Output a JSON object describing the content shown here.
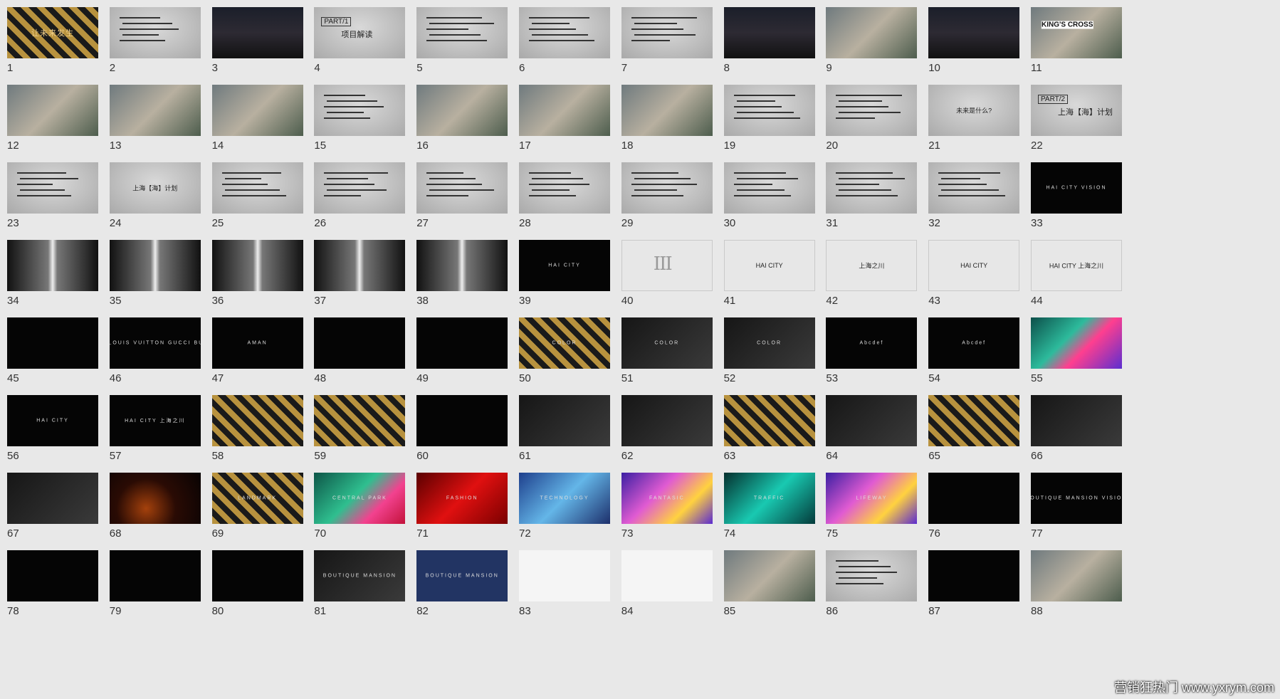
{
  "slides": [
    {
      "n": "1",
      "style": "gold",
      "caption": "让未来发生"
    },
    {
      "n": "2",
      "style": "gray"
    },
    {
      "n": "3",
      "style": "city"
    },
    {
      "n": "4",
      "style": "gray",
      "part": "PART/1",
      "part_title": "项目解读"
    },
    {
      "n": "5",
      "style": "gray"
    },
    {
      "n": "6",
      "style": "gray"
    },
    {
      "n": "7",
      "style": "gray"
    },
    {
      "n": "8",
      "style": "city"
    },
    {
      "n": "9",
      "style": "photo"
    },
    {
      "n": "10",
      "style": "city"
    },
    {
      "n": "11",
      "style": "photo",
      "caption": "KING'S CROSS"
    },
    {
      "n": "12",
      "style": "photo"
    },
    {
      "n": "13",
      "style": "photo"
    },
    {
      "n": "14",
      "style": "photo"
    },
    {
      "n": "15",
      "style": "gray"
    },
    {
      "n": "16",
      "style": "photo"
    },
    {
      "n": "17",
      "style": "photo"
    },
    {
      "n": "18",
      "style": "photo"
    },
    {
      "n": "19",
      "style": "gray"
    },
    {
      "n": "20",
      "style": "gray"
    },
    {
      "n": "21",
      "style": "gray",
      "caption": "未来是什么?"
    },
    {
      "n": "22",
      "style": "gray",
      "part": "PART/2",
      "part_title": "上海【海】计划"
    },
    {
      "n": "23",
      "style": "gray"
    },
    {
      "n": "24",
      "style": "gray",
      "caption": "上海【海】计划"
    },
    {
      "n": "25",
      "style": "gray"
    },
    {
      "n": "26",
      "style": "gray"
    },
    {
      "n": "27",
      "style": "gray"
    },
    {
      "n": "28",
      "style": "gray"
    },
    {
      "n": "29",
      "style": "gray"
    },
    {
      "n": "30",
      "style": "gray"
    },
    {
      "n": "31",
      "style": "gray"
    },
    {
      "n": "32",
      "style": "gray"
    },
    {
      "n": "33",
      "style": "black",
      "caption": "HAI CITY VISION"
    },
    {
      "n": "34",
      "style": "bw"
    },
    {
      "n": "35",
      "style": "bw"
    },
    {
      "n": "36",
      "style": "bw"
    },
    {
      "n": "37",
      "style": "bw"
    },
    {
      "n": "38",
      "style": "bw"
    },
    {
      "n": "39",
      "style": "black",
      "caption": "HAI CITY"
    },
    {
      "n": "40",
      "style": "light",
      "glyph": "III"
    },
    {
      "n": "41",
      "style": "light",
      "caption": "HAI CITY"
    },
    {
      "n": "42",
      "style": "light",
      "caption": "上海之川"
    },
    {
      "n": "43",
      "style": "light",
      "caption": "HAI CITY"
    },
    {
      "n": "44",
      "style": "light",
      "caption": "HAI CITY 上海之川"
    },
    {
      "n": "45",
      "style": "black"
    },
    {
      "n": "46",
      "style": "black",
      "caption": "CHANEL  LOUIS VUITTON  GUCCI  BURBERRY"
    },
    {
      "n": "47",
      "style": "black",
      "caption": "AMAN"
    },
    {
      "n": "48",
      "style": "black"
    },
    {
      "n": "49",
      "style": "black"
    },
    {
      "n": "50",
      "style": "gold",
      "caption": "COLOR"
    },
    {
      "n": "51",
      "style": "dark",
      "caption": "COLOR"
    },
    {
      "n": "52",
      "style": "dark",
      "caption": "COLOR"
    },
    {
      "n": "53",
      "style": "black",
      "caption": "Abcdef"
    },
    {
      "n": "54",
      "style": "black",
      "caption": "Abcdef"
    },
    {
      "n": "55",
      "style": "multi"
    },
    {
      "n": "56",
      "style": "black",
      "caption": "HAI CITY"
    },
    {
      "n": "57",
      "style": "black",
      "caption": "HAI CITY 上海之川"
    },
    {
      "n": "58",
      "style": "gold"
    },
    {
      "n": "59",
      "style": "gold"
    },
    {
      "n": "60",
      "style": "black"
    },
    {
      "n": "61",
      "style": "dark"
    },
    {
      "n": "62",
      "style": "dark"
    },
    {
      "n": "63",
      "style": "gold"
    },
    {
      "n": "64",
      "style": "dark"
    },
    {
      "n": "65",
      "style": "gold"
    },
    {
      "n": "66",
      "style": "dark"
    },
    {
      "n": "67",
      "style": "dark"
    },
    {
      "n": "68",
      "style": "orange"
    },
    {
      "n": "69",
      "style": "gold",
      "caption": "LANDMARK"
    },
    {
      "n": "70",
      "style": "pink",
      "caption": "CENTRAL PARK"
    },
    {
      "n": "71",
      "style": "red",
      "caption": "FASHION"
    },
    {
      "n": "72",
      "style": "blue",
      "caption": "TECHNOLOGY"
    },
    {
      "n": "73",
      "style": "purple",
      "caption": "FANTASIC"
    },
    {
      "n": "74",
      "style": "teal",
      "caption": "TRAFFIC"
    },
    {
      "n": "75",
      "style": "purple",
      "caption": "LIFEWAY"
    },
    {
      "n": "76",
      "style": "black"
    },
    {
      "n": "77",
      "style": "black",
      "caption": "BOUTIQUE MANSION VISION"
    },
    {
      "n": "78",
      "style": "black"
    },
    {
      "n": "79",
      "style": "black"
    },
    {
      "n": "80",
      "style": "black"
    },
    {
      "n": "81",
      "style": "dark",
      "caption": "BOUTIQUE MANSION"
    },
    {
      "n": "82",
      "style": "navy",
      "caption": "BOUTIQUE MANSION"
    },
    {
      "n": "83",
      "style": "white"
    },
    {
      "n": "84",
      "style": "white"
    },
    {
      "n": "85",
      "style": "photo"
    },
    {
      "n": "86",
      "style": "gray"
    },
    {
      "n": "87",
      "style": "black"
    },
    {
      "n": "88",
      "style": "photo"
    }
  ],
  "watermark": "营销狂热门 www.yxrym.com"
}
